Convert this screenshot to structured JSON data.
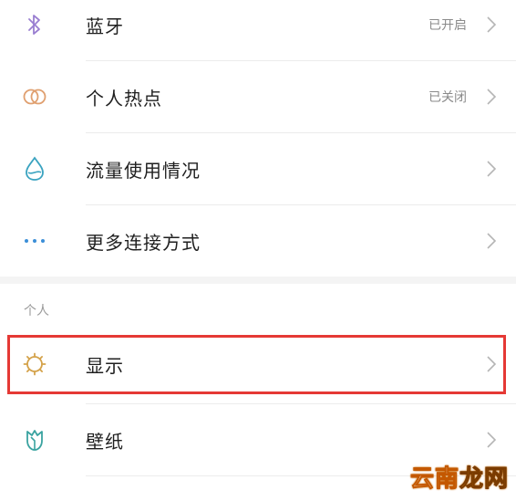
{
  "rows": [
    {
      "label": "蓝牙",
      "status": "已开启",
      "icon": "bluetooth-icon"
    },
    {
      "label": "个人热点",
      "status": "已关闭",
      "icon": "hotspot-icon"
    },
    {
      "label": "流量使用情况",
      "status": "",
      "icon": "data-usage-icon"
    },
    {
      "label": "更多连接方式",
      "status": "",
      "icon": "more-dots-icon"
    }
  ],
  "section": {
    "title": "个人"
  },
  "personal_rows": [
    {
      "label": "显示",
      "icon": "display-sun-icon",
      "highlighted": true
    },
    {
      "label": "壁纸",
      "icon": "wallpaper-tulip-icon"
    }
  ],
  "watermark": {
    "part1": "云南",
    "part2": "龙网"
  },
  "colors": {
    "bluetooth": "#9a7fd1",
    "hotspot": "#e0a070",
    "data_usage": "#3aa3c0",
    "more": "#3b8fd8",
    "display": "#d4a24a",
    "wallpaper": "#3aa3a0",
    "highlight": "#e53935"
  }
}
